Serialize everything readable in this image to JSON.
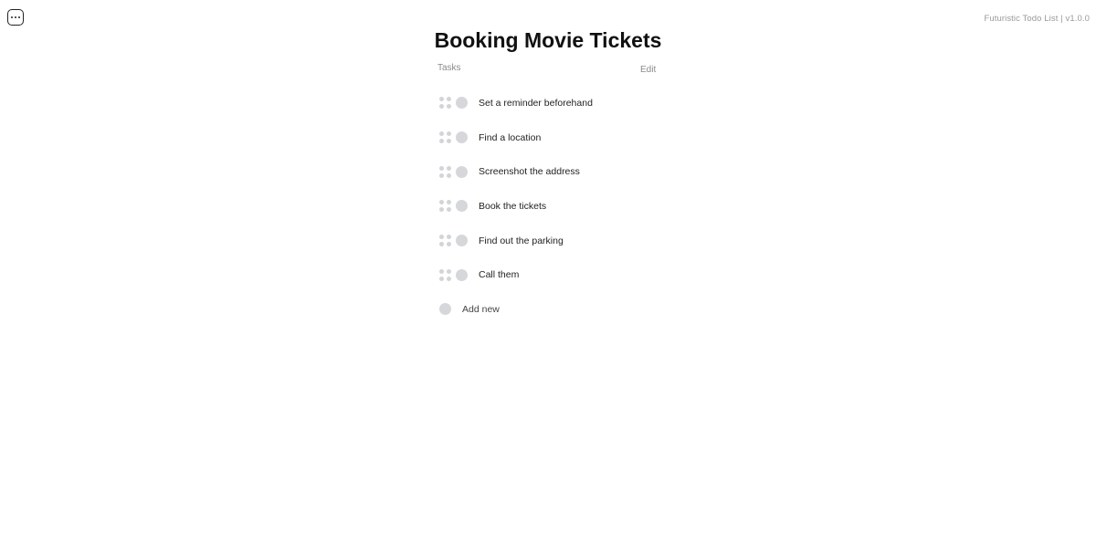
{
  "header": {
    "menu_icon": "more-horizontal-square-icon",
    "app_version": "Futuristic Todo List | v1.0.0"
  },
  "list": {
    "title": "Booking Movie Tickets",
    "section_label": "Tasks",
    "edit_label": "Edit",
    "tasks": [
      {
        "label": "Set a reminder beforehand",
        "done": false
      },
      {
        "label": "Find a location",
        "done": false
      },
      {
        "label": "Screenshot the address",
        "done": false
      },
      {
        "label": "Book the tickets",
        "done": false
      },
      {
        "label": "Find out the parking",
        "done": false
      },
      {
        "label": "Call them",
        "done": false
      }
    ],
    "add_new_label": "Add new"
  },
  "colors": {
    "grip": "#d3d4d8",
    "checkbox": "#d6d7db",
    "muted_text": "#8a8a8a"
  }
}
